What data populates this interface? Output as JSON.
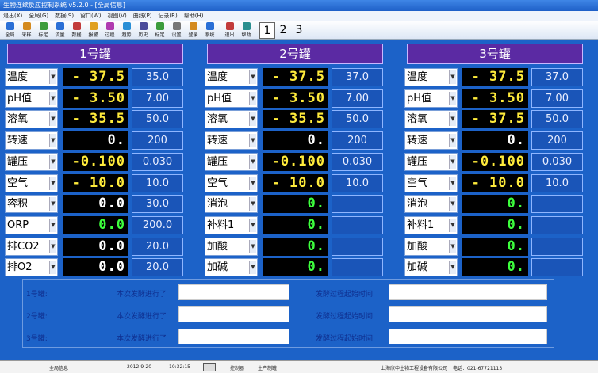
{
  "window": {
    "title": "生物连续反应控制系统 v5.2.0 - [全局信息]"
  },
  "menu": [
    "退出(X)",
    "全局(G)",
    "数据(S)",
    "窗口(W)",
    "视图(V)",
    "曲线(P)",
    "记录(R)",
    "帮助(H)"
  ],
  "toolbar": {
    "buttons": [
      {
        "label": "全局",
        "color": "#2a6fd6"
      },
      {
        "label": "采样",
        "color": "#d48a1f"
      },
      {
        "label": "标定",
        "color": "#3c9c3c"
      },
      {
        "label": "流量",
        "color": "#2a6fd6"
      },
      {
        "label": "数据",
        "color": "#c23b3b"
      },
      {
        "label": "报警",
        "color": "#e0a020"
      },
      {
        "label": "过程",
        "color": "#b03bb0"
      },
      {
        "label": "趋势",
        "color": "#2a8fd6"
      },
      {
        "label": "历史",
        "color": "#4a4a9a"
      },
      {
        "label": "标定",
        "color": "#3c9c3c"
      },
      {
        "label": "设置",
        "color": "#777777"
      },
      {
        "label": "登录",
        "color": "#d48a1f"
      },
      {
        "label": "系统",
        "color": "#2a6fd6"
      },
      {
        "label": "退出",
        "color": "#c23b3b"
      },
      {
        "label": "帮助",
        "color": "#2a8f8f"
      }
    ],
    "pages": [
      "1",
      "2",
      "3"
    ],
    "active_page": "1"
  },
  "tanks": [
    {
      "name": "1号罐",
      "rows": [
        {
          "label": "温度",
          "value": "- 37.5",
          "color": "y",
          "setpoint": "35.0"
        },
        {
          "label": "pH值",
          "value": "- 3.50",
          "color": "y",
          "setpoint": "7.00"
        },
        {
          "label": "溶氧",
          "value": "- 35.5",
          "color": "y",
          "setpoint": "50.0"
        },
        {
          "label": "转速",
          "value": "0.",
          "color": "w",
          "setpoint": "200"
        },
        {
          "label": "罐压",
          "value": "-0.100",
          "color": "y",
          "setpoint": "0.030"
        },
        {
          "label": "空气",
          "value": "- 10.0",
          "color": "y",
          "setpoint": "10.0"
        },
        {
          "label": "容积",
          "value": "0.0",
          "color": "w",
          "setpoint": "30.0"
        },
        {
          "label": "ORP",
          "value": "0.0",
          "color": "g",
          "setpoint": "200.0"
        },
        {
          "label": "排CO2",
          "value": "0.0",
          "color": "w",
          "setpoint": "20.0"
        },
        {
          "label": "排O2",
          "value": "0.0",
          "color": "w",
          "setpoint": "20.0"
        }
      ]
    },
    {
      "name": "2号罐",
      "rows": [
        {
          "label": "温度",
          "value": "- 37.5",
          "color": "y",
          "setpoint": "37.0"
        },
        {
          "label": "pH值",
          "value": "- 3.50",
          "color": "y",
          "setpoint": "7.00"
        },
        {
          "label": "溶氧",
          "value": "- 35.5",
          "color": "y",
          "setpoint": "50.0"
        },
        {
          "label": "转速",
          "value": "0.",
          "color": "w",
          "setpoint": "200"
        },
        {
          "label": "罐压",
          "value": "-0.100",
          "color": "y",
          "setpoint": "0.030"
        },
        {
          "label": "空气",
          "value": "- 10.0",
          "color": "y",
          "setpoint": "10.0"
        },
        {
          "label": "消泡",
          "value": "0.",
          "color": "g",
          "setpoint": ""
        },
        {
          "label": "补料1",
          "value": "0.",
          "color": "g",
          "setpoint": ""
        },
        {
          "label": "加酸",
          "value": "0.",
          "color": "g",
          "setpoint": ""
        },
        {
          "label": "加碱",
          "value": "0.",
          "color": "g",
          "setpoint": ""
        }
      ]
    },
    {
      "name": "3号罐",
      "rows": [
        {
          "label": "温度",
          "value": "- 37.5",
          "color": "y",
          "setpoint": "37.0"
        },
        {
          "label": "pH值",
          "value": "- 3.50",
          "color": "y",
          "setpoint": "7.00"
        },
        {
          "label": "溶氧",
          "value": "- 37.5",
          "color": "y",
          "setpoint": "50.0"
        },
        {
          "label": "转速",
          "value": "0.",
          "color": "w",
          "setpoint": "200"
        },
        {
          "label": "罐压",
          "value": "-0.100",
          "color": "y",
          "setpoint": "0.030"
        },
        {
          "label": "空气",
          "value": "- 10.0",
          "color": "y",
          "setpoint": "10.0"
        },
        {
          "label": "消泡",
          "value": "0.",
          "color": "g",
          "setpoint": ""
        },
        {
          "label": "补料1",
          "value": "0.",
          "color": "g",
          "setpoint": ""
        },
        {
          "label": "加酸",
          "value": "0.",
          "color": "g",
          "setpoint": ""
        },
        {
          "label": "加碱",
          "value": "0.",
          "color": "g",
          "setpoint": ""
        }
      ]
    }
  ],
  "bottom": {
    "rows": [
      {
        "name": "1号罐:",
        "label1": "本次发酵进行了",
        "label2": "发酵过程起始时间"
      },
      {
        "name": "2号罐:",
        "label1": "本次发酵进行了",
        "label2": "发酵过程起始时间"
      },
      {
        "name": "3号罐:",
        "label1": "本次发酵进行了",
        "label2": "发酵过程起始时间"
      }
    ]
  },
  "statusbar": {
    "view": "全局信息",
    "date": "2012-9-20",
    "time": "10:32:15",
    "mode": "控制器",
    "state": "生产制罐",
    "company": "上海欣中生物工程设备有限公司",
    "phone": "电话：021-67721113"
  }
}
